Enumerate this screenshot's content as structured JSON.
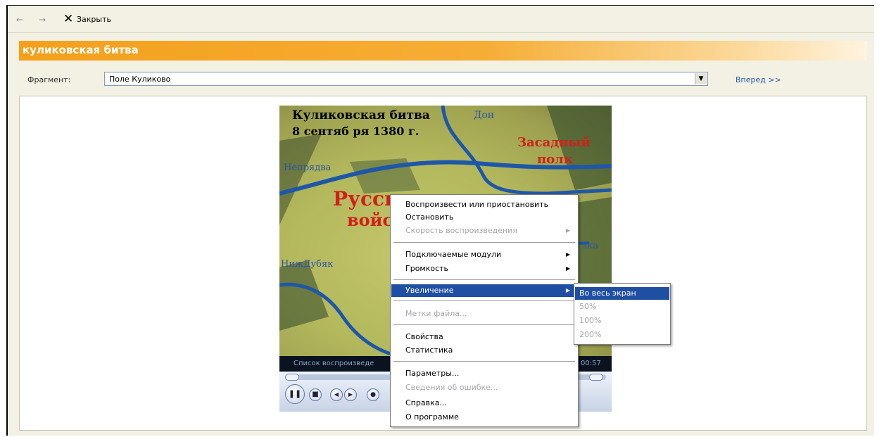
{
  "toolbar": {
    "back_icon": "arrow-left-icon",
    "forward_icon": "arrow-right-icon",
    "close_icon": "close-icon",
    "close_label": "Закрыть"
  },
  "header": {
    "title": "куликовская битва",
    "fragment_label": "Фрагмент:",
    "fragment_value": "Поле Куликово",
    "next_link": "Вперед >>"
  },
  "map": {
    "title_line1": "Куликовская битва",
    "title_line2": "8 сентяб ря 1380 г.",
    "river_don": "Дон",
    "river_nepryadva": "Непрядва",
    "ambush_line1": "Засадный",
    "ambush_line2": "полк",
    "army_line1": "Русск",
    "army_line2": "войск",
    "place_nizhdubyak": "НижДубяк",
    "partial_label": "зка"
  },
  "player": {
    "status_text": "Список воспроизведе",
    "time": "00:57"
  },
  "context_menu": {
    "items": [
      {
        "label": "Воспроизвести или приостановить",
        "disabled": false
      },
      {
        "label": "Остановить",
        "disabled": false
      },
      {
        "label": "Скорость воспроизведения",
        "disabled": true,
        "submenu": true
      },
      {
        "label": "Подключаемые модули",
        "disabled": false,
        "submenu": true
      },
      {
        "label": "Громкость",
        "disabled": false,
        "submenu": true
      },
      {
        "label": "Увеличение",
        "disabled": false,
        "submenu": true,
        "highlighted": true
      },
      {
        "label": "Метки файла...",
        "disabled": true
      },
      {
        "label": "Свойства",
        "disabled": false
      },
      {
        "label": "Статистика",
        "disabled": false
      },
      {
        "label": "Параметры...",
        "disabled": false
      },
      {
        "label": "Сведения об ошибке...",
        "disabled": true
      },
      {
        "label": "Справка...",
        "disabled": false
      },
      {
        "label": "О программе",
        "disabled": false
      }
    ]
  },
  "zoom_submenu": {
    "items": [
      {
        "label": "Во весь экран",
        "highlighted": true
      },
      {
        "label": "50%",
        "disabled": true
      },
      {
        "label": "100%",
        "disabled": true
      },
      {
        "label": "200%",
        "disabled": true
      }
    ]
  },
  "colors": {
    "title_bar": "#f4a01b",
    "menu_highlight": "#1f4fa3",
    "link": "#1f5ba8",
    "map_red_text": "#d0201a"
  }
}
